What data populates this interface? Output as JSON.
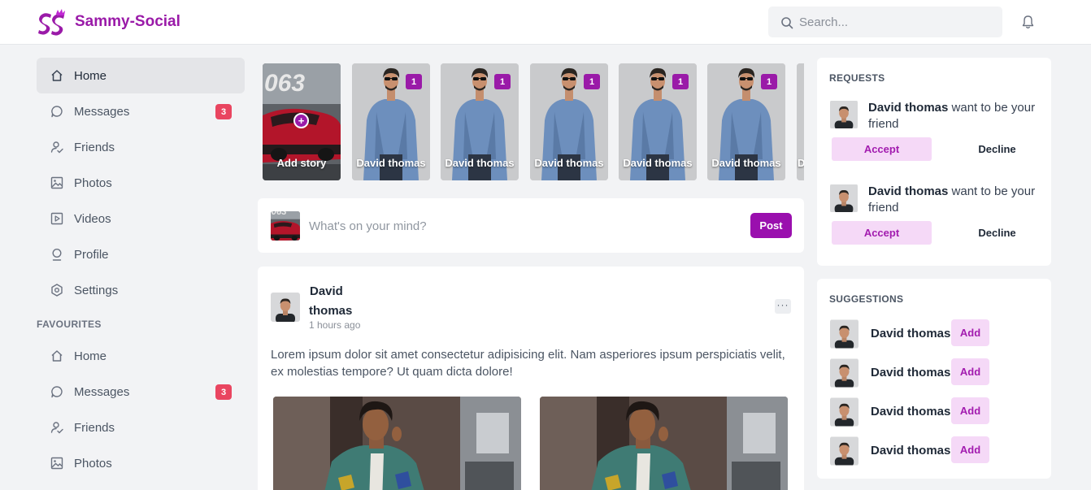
{
  "app": {
    "name": "Sammy-Social"
  },
  "search": {
    "placeholder": "Search..."
  },
  "sidebar": {
    "main": [
      {
        "label": "Home",
        "icon": "home-icon",
        "active": true
      },
      {
        "label": "Messages",
        "icon": "chat-icon",
        "badge": "3"
      },
      {
        "label": "Friends",
        "icon": "friends-icon"
      },
      {
        "label": "Photos",
        "icon": "image-icon"
      },
      {
        "label": "Videos",
        "icon": "video-icon"
      },
      {
        "label": "Profile",
        "icon": "profile-icon"
      },
      {
        "label": "Settings",
        "icon": "settings-icon"
      }
    ],
    "favourites_title": "FAVOURITES",
    "favourites": [
      {
        "label": "Home",
        "icon": "home-icon"
      },
      {
        "label": "Messages",
        "icon": "chat-icon",
        "badge": "3"
      },
      {
        "label": "Friends",
        "icon": "friends-icon"
      },
      {
        "label": "Photos",
        "icon": "image-icon"
      }
    ]
  },
  "stories": {
    "add_label": "Add story",
    "items": [
      {
        "name": "David thomas",
        "count": "1"
      },
      {
        "name": "David thomas",
        "count": "1"
      },
      {
        "name": "David thomas",
        "count": "1"
      },
      {
        "name": "David thomas",
        "count": "1"
      },
      {
        "name": "David thomas",
        "count": "1"
      },
      {
        "name": "D"
      }
    ]
  },
  "composer": {
    "placeholder": "What's on your mind?",
    "post_label": "Post"
  },
  "post": {
    "author_first": "David",
    "author_last": "thomas",
    "time": "1 hours ago",
    "more_label": "···",
    "body": "Lorem ipsum dolor sit amet consectetur adipisicing elit. Nam asperiores ipsum perspiciatis velit, ex molestias tempore? Ut quam dicta dolore!"
  },
  "requests": {
    "title": "REQUESTS",
    "items": [
      {
        "name": "David thomas",
        "text": "want to be your friend",
        "accept": "Accept",
        "decline": "Decline"
      },
      {
        "name": "David thomas",
        "text": "want to be your friend",
        "accept": "Accept",
        "decline": "Decline"
      }
    ]
  },
  "suggestions": {
    "title": "SUGGESTIONS",
    "items": [
      {
        "name": "David thomas",
        "add": "Add"
      },
      {
        "name": "David thomas",
        "add": "Add"
      },
      {
        "name": "David thomas",
        "add": "Add"
      },
      {
        "name": "David thomas",
        "add": "Add"
      }
    ]
  },
  "colors": {
    "brand": "#9a1aa8",
    "badge": "#e94560",
    "accent_soft": "#f5d9f7"
  }
}
